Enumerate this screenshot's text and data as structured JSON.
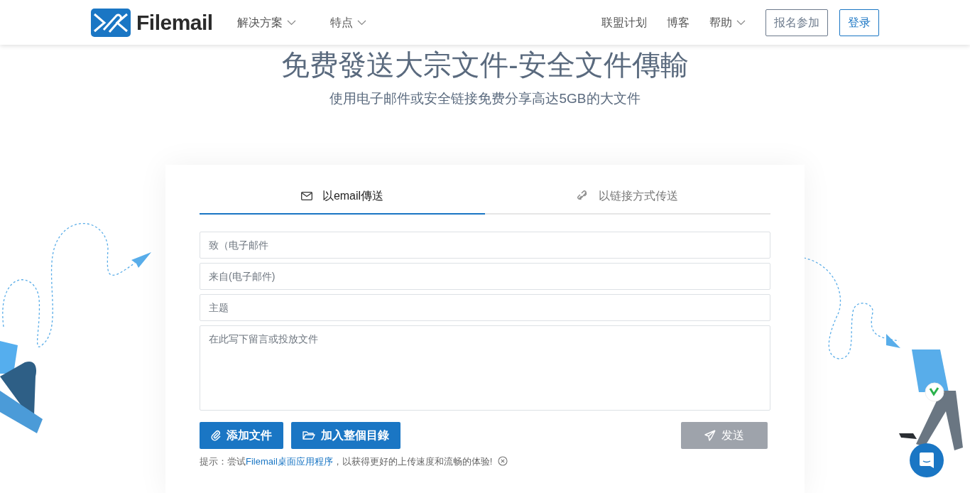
{
  "header": {
    "logo_text": "Filemail",
    "nav_left": [
      {
        "label": "解决方案",
        "dropdown": true
      },
      {
        "label": "特点",
        "dropdown": true
      }
    ],
    "nav_right": [
      {
        "label": "联盟计划",
        "dropdown": false
      },
      {
        "label": "博客",
        "dropdown": false
      },
      {
        "label": "帮助",
        "dropdown": true
      }
    ],
    "signup_button": "报名参加",
    "login_button": "登录"
  },
  "hero": {
    "title": "免费發送大宗文件-安全文件傳輸",
    "subtitle": "使用电子邮件或安全链接免费分享高达5GB的大文件"
  },
  "form": {
    "tabs": [
      {
        "label": "以email傳送",
        "kind": "envelope",
        "selected": true
      },
      {
        "label": "以链接方式传送",
        "kind": "link",
        "selected": false
      }
    ],
    "fields": [
      {
        "kind": "input",
        "placeholder": "致（电子邮件"
      },
      {
        "kind": "input",
        "placeholder": "来自(电子邮件)"
      },
      {
        "kind": "input",
        "placeholder": "主题"
      },
      {
        "kind": "textarea",
        "placeholder": "在此写下留言或投放文件"
      }
    ],
    "buttons": [
      {
        "label": "添加文件",
        "kind": "paperclip"
      },
      {
        "label": "加入整個目錄",
        "kind": "folder"
      }
    ],
    "send_button": {
      "label": "发送",
      "disabled": true
    },
    "hint": {
      "before": "提示：尝试",
      "link": "Filemail桌面应用程序",
      "after": "，以获得更好的上传速度和流畅的体验!"
    }
  }
}
